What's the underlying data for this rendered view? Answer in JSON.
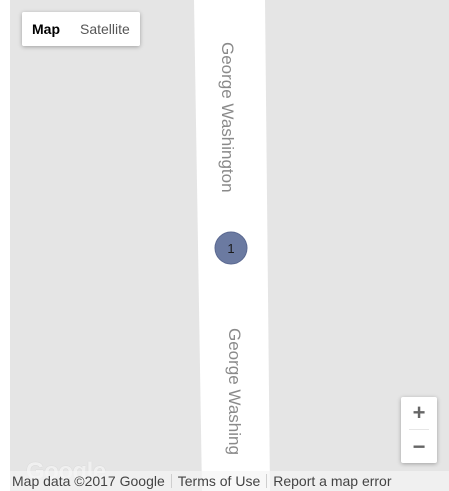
{
  "map": {
    "map_type_control": {
      "options": [
        "Map",
        "Satellite"
      ],
      "selected": "Map"
    },
    "road": {
      "name_upper": "George Washington",
      "name_lower": "George Washing"
    },
    "marker": {
      "count": "1",
      "color": "#6b7aa1"
    },
    "zoom": {
      "in_label": "+",
      "out_label": "−"
    },
    "logo_text": "Google",
    "footer": {
      "map_data": "Map data ©2017 Google",
      "terms": "Terms of Use",
      "report": "Report a map error"
    },
    "colors": {
      "land": "#e5e5e5",
      "road": "#ffffff",
      "road_label": "#8a8a8a"
    }
  }
}
